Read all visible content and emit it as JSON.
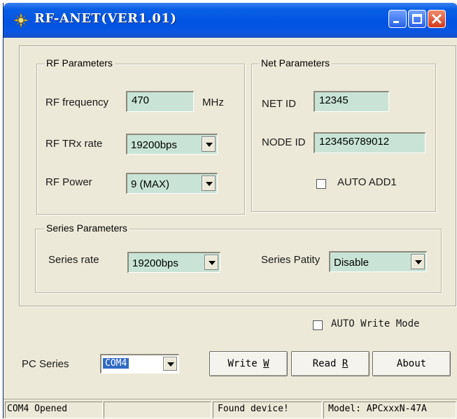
{
  "window": {
    "title": "RF-ANET(VER1.01)",
    "icon": "app-icon",
    "controls": {
      "minimize": "minimize-icon",
      "maximize": "maximize-icon",
      "close": "close-icon"
    }
  },
  "rf_parameters": {
    "legend": "RF Parameters",
    "frequency_label": "RF frequency",
    "frequency_value": "470",
    "frequency_unit": "MHz",
    "trx_rate_label": "RF TRx rate",
    "trx_rate_value": "19200bps",
    "power_label": "RF Power",
    "power_value": "9 (MAX)"
  },
  "net_parameters": {
    "legend": "Net Parameters",
    "net_id_label": "NET ID",
    "net_id_value": "12345",
    "node_id_label": "NODE ID",
    "node_id_value": "123456789012",
    "auto_add_label": "AUTO ADD1",
    "auto_add_checked": false
  },
  "series_parameters": {
    "legend": "Series Parameters",
    "rate_label": "Series rate",
    "rate_value": "19200bps",
    "parity_label": "Series Patity",
    "parity_value": "Disable"
  },
  "auto_write": {
    "label": "AUTO Write Mode",
    "checked": false
  },
  "pc_series": {
    "label": "PC Series",
    "value": "COM4"
  },
  "buttons": {
    "write": "Write W",
    "read": "Read R",
    "about": "About"
  },
  "statusbar": {
    "port": "COM4 Opened",
    "blank": "",
    "device": "Found device!",
    "model": "Model: APCxxxN-47A"
  },
  "colors": {
    "field_bg": "#c9e4d6",
    "window_bg": "#ece9d8",
    "title_blue": "#0053e1"
  }
}
